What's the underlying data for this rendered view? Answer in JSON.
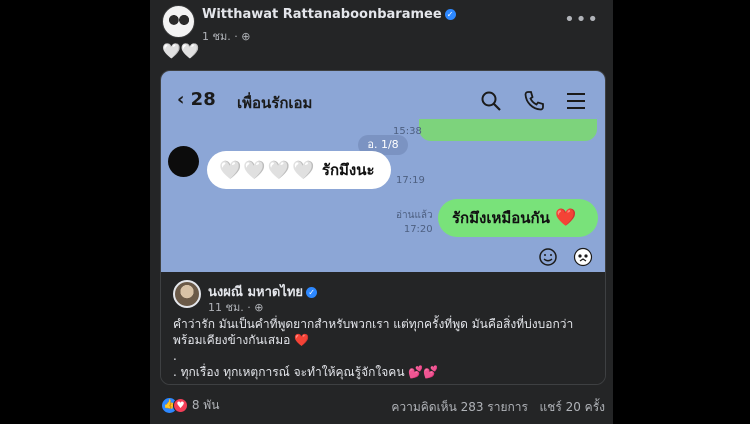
{
  "post": {
    "author": "Witthawat Rattanaboonbaramee",
    "time": "1 ชม. · ",
    "privacy_icon": "globe-icon",
    "more_icon": "ellipsis-icon",
    "caption": "🤍🤍"
  },
  "chat": {
    "back_label": "‹ 28",
    "chat_name": "เพื่อนรักเอม",
    "date_label": "อ. 1/8",
    "time_top": "15:38",
    "friend_message_hearts": "🤍🤍🤍🤍",
    "friend_message_text": "รักมึงนะ",
    "friend_time": "17:19",
    "read_label": "อ่านแล้ว",
    "my_time": "17:20",
    "my_message_text": "รักมึงเหมือนกัน",
    "my_message_emoji": "❤️"
  },
  "embed": {
    "author": "นงผณี มหาดไทย",
    "time": "11 ชม. · ",
    "line1": "คำว่ารัก มันเป็นคำที่พูดยากสำหรับพวกเรา แต่ทุกครั้งที่พูด มันคือสิ่งที่บ่งบอกว่า พร้อมเคียงข้างกันเสมอ ❤️",
    "line2": ".",
    "line3": ". ทุกเรื่อง ทุกเหตุการณ์ จะทำให้คุณรู้จักใจคน 💕💕"
  },
  "footer": {
    "reaction_count": "8 พัน",
    "comments": "ความคิดเห็น 283 รายการ",
    "shares": "แชร์ 20 ครั้ง"
  },
  "colors": {
    "chat_bg": "#8ca6d6",
    "green_bubble": "#79e27a",
    "fb_blue": "#2d88ff"
  }
}
